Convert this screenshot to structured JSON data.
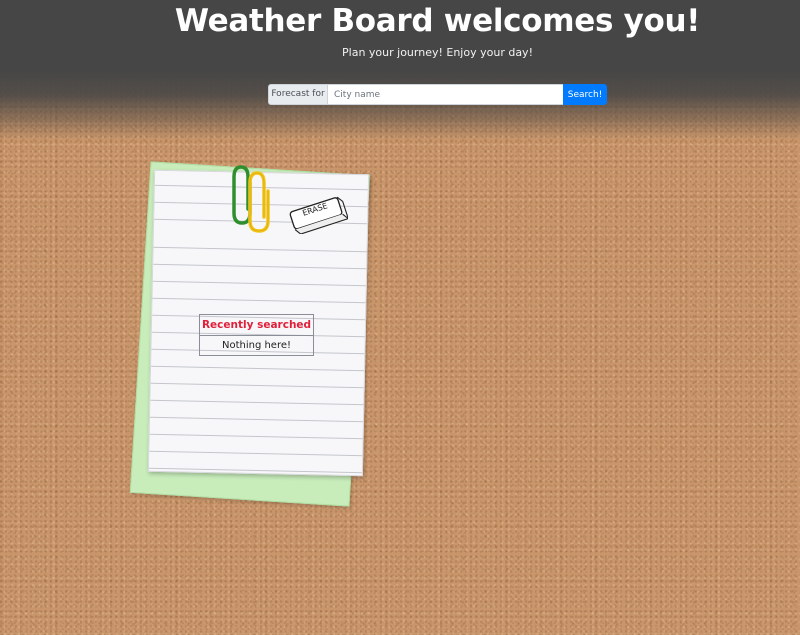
{
  "header": {
    "title": "Weather Board welcomes you!",
    "subtitle": "Plan your journey! Enjoy your day!"
  },
  "search": {
    "prefix_label": "Forecast for",
    "placeholder": "City name",
    "value": "",
    "button_label": "Search!"
  },
  "notes": {
    "erase_label": "ERASE",
    "recent_title": "Recently searched",
    "recent_empty": "Nothing here!",
    "clip_colors": [
      "#2f8f2f",
      "#f3c51a"
    ],
    "paper_color": "#f7f7f9",
    "sticky_color": "#c8edbb"
  },
  "colors": {
    "header_bg": "#464646",
    "accent": "#007bff",
    "recent_title": "#e0203a",
    "corkboard": "#c9966b"
  },
  "icons": {
    "clips": "paperclip-icon",
    "eraser": "eraser-icon"
  }
}
